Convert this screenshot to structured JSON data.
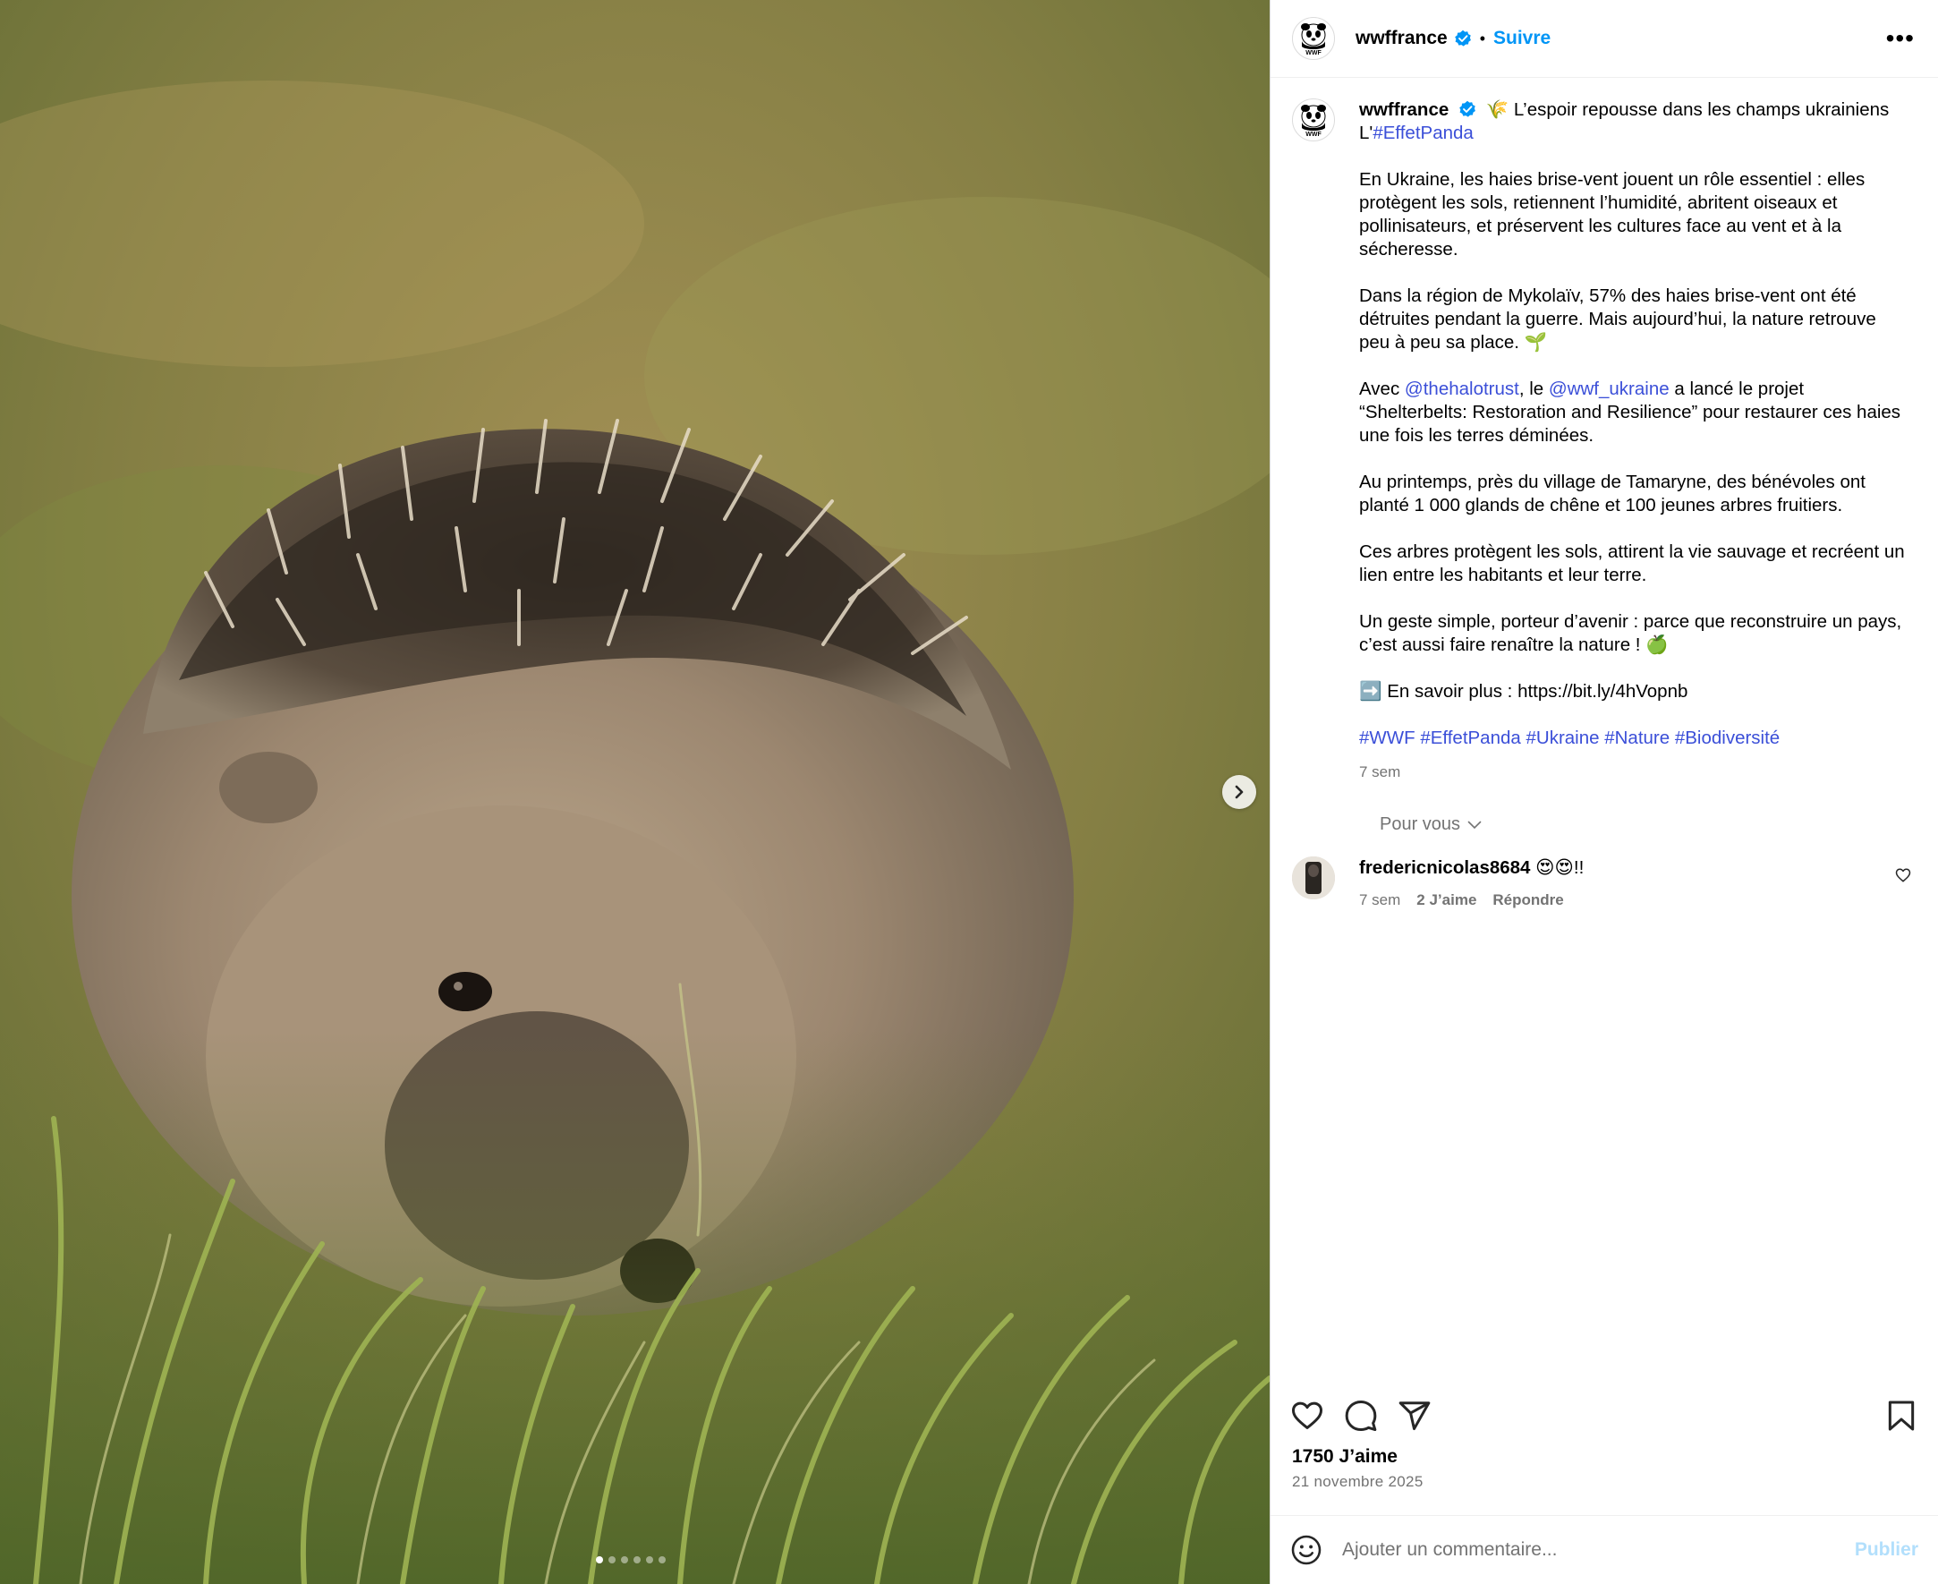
{
  "media": {
    "carousel_dots": 6,
    "active_dot": 0
  },
  "header": {
    "username": "wwffrance",
    "separator": "•",
    "follow_label": "Suivre",
    "more_icon": "more-options-icon"
  },
  "caption": {
    "username": "wwffrance",
    "title_emoji": "🌾",
    "title_text": "L’espoir repousse dans les champs ukrainiens L'",
    "title_tag": "#EffetPanda",
    "p1": "En Ukraine, les haies brise-vent jouent un rôle essentiel : elles protègent les sols, retiennent l’humidité, abritent oiseaux et pollinisateurs, et préservent les cultures face au vent et à la sécheresse.",
    "p2": "Dans la région de Mykolaïv, 57% des haies brise-vent ont été détruites pendant la guerre. Mais aujourd’hui, la nature retrouve peu à peu sa place. 🌱",
    "p3_pre": "Avec ",
    "p3_mention1": "@thehalotrust",
    "p3_mid": ", le ",
    "p3_mention2": "@wwf_ukraine",
    "p3_post": " a lancé le projet “Shelterbelts: Restoration and Resilience” pour restaurer ces haies une fois les terres déminées.",
    "p4": "Au printemps, près du village de Tamaryne, des bénévoles ont planté 1 000 glands de chêne et 100 jeunes arbres fruitiers.",
    "p5": "Ces arbres protègent les sols, attirent la vie sauvage et recréent un lien entre les habitants et leur terre.",
    "p6": "Un geste simple, porteur d’avenir : parce que reconstruire un pays, c’est aussi faire renaître la nature ! 🍏",
    "p7": "➡️ En savoir plus : https://bit.ly/4hVopnb",
    "hashtags": "#WWF #EffetPanda #Ukraine #Nature #Biodiversité",
    "time": "7 sem"
  },
  "comments_section": {
    "filter_label": "Pour vous",
    "items": [
      {
        "username": "fredericnicolas8684",
        "text": "😍😍!!",
        "time": "7 sem",
        "likes": "2 J’aime",
        "reply": "Répondre"
      }
    ]
  },
  "footer": {
    "likes": "1750 J’aime",
    "date": "21 novembre 2025"
  },
  "comment_box": {
    "placeholder": "Ajouter un commentaire...",
    "publish": "Publier"
  },
  "colors": {
    "link": "#3b4fd8",
    "follow": "#0095f6",
    "muted": "#737373",
    "verified": "#0095f6"
  }
}
